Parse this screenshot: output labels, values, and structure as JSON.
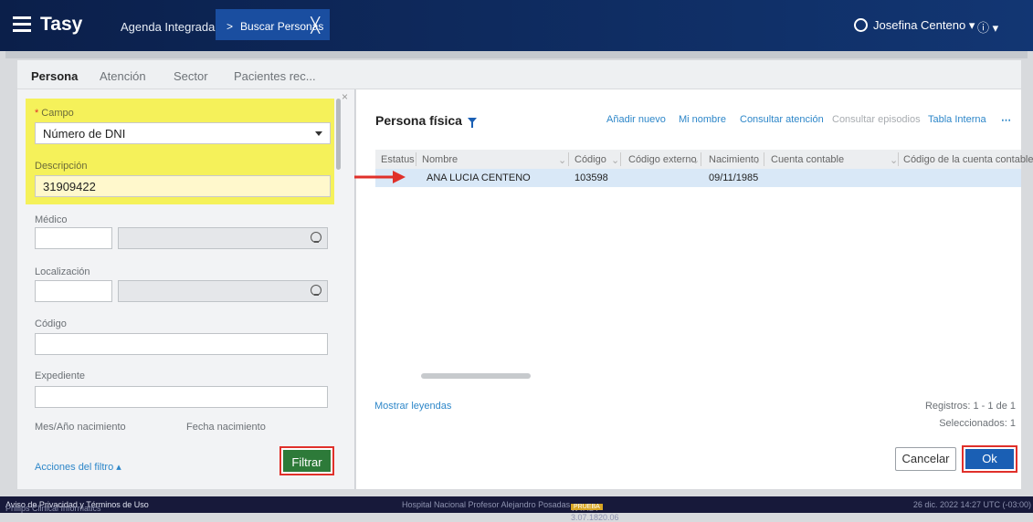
{
  "topbar": {
    "brand": "Tasy",
    "breadcrumb_1": "Agenda Integrada",
    "breadcrumb_chevron": ">",
    "active_tab": "Buscar Personas",
    "close_glyph": "╳",
    "user_name": "Josefina Centeno",
    "user_caret": "▾",
    "info_label": "ⓘ ▾"
  },
  "tabs": [
    "Persona",
    "Atención",
    "Sector",
    "Pacientes rec..."
  ],
  "filter": {
    "close_glyph": "×",
    "campo_label": "Campo",
    "required_mark": "*",
    "campo_value": "Número de DNI",
    "descripcion_label": "Descripción",
    "descripcion_value": "31909422",
    "medico_label": "Médico",
    "localizacion_label": "Localización",
    "codigo_label": "Código",
    "expediente_label": "Expediente",
    "mes_anio_label": "Mes/Año nacimiento",
    "fecha_label": "Fecha nacimiento",
    "acciones_label": "Acciones del filtro ▴",
    "filtrar_label": "Filtrar"
  },
  "results": {
    "title": "Persona física",
    "actions": [
      "Añadir nuevo",
      "Mi nombre",
      "Consultar atención",
      "Consultar episodios",
      "Tabla Interna",
      "⋯"
    ],
    "columns": [
      "Estatus",
      "Nombre",
      "Código",
      "Código externo",
      "Nacimiento",
      "Cuenta contable",
      "Código de la cuenta contable"
    ],
    "sort_glyph": "⌄",
    "rows": [
      {
        "estatus": "",
        "nombre": "ANA LUCIA CENTENO",
        "codigo": "103598",
        "codigo_externo": "",
        "nacimiento": "09/11/1985",
        "cuenta": "",
        "codigo_cuenta": ""
      }
    ],
    "mostrar_leyendas": "Mostrar leyendas",
    "registros": "Registros: 1 - 1 de 1",
    "seleccionados": "Seleccionados: 1",
    "cancel_label": "Cancelar",
    "ok_label": "Ok"
  },
  "footer": {
    "company": "Philips Clinical Informatics",
    "privacy": "Aviso de Privacidad y Términos de Uso",
    "hospital": "Hospital Nacional Profesor Alejandro Posadas",
    "version": "WTASY 3.07.1820.06",
    "badge": "PRUEBA",
    "datetime": "26 dic. 2022 14:27 UTC (-03:00)"
  },
  "colors": {
    "accent": "#1a5fb4",
    "highlight": "#f5f15a",
    "filter_button": "#2d7a39",
    "annotation_red": "#e0302a"
  }
}
